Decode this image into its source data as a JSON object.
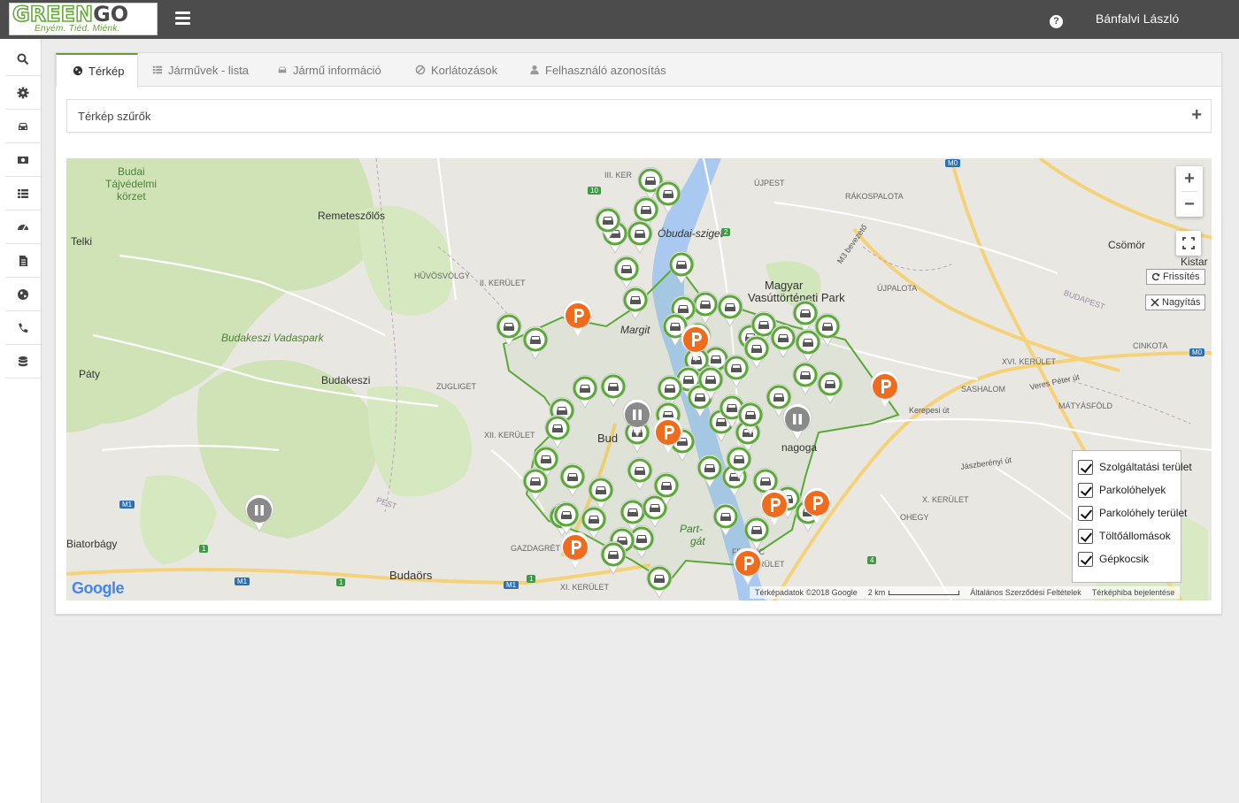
{
  "header": {
    "logo_text_1": "GREEN",
    "logo_text_2": "GO",
    "logo_tagline": "Enyém. Tiéd. Miénk.",
    "help_glyph": "?",
    "user_name": "Bánfalvi László"
  },
  "sidebar": {
    "items": [
      {
        "icon": "search-icon"
      },
      {
        "icon": "gear-icon"
      },
      {
        "icon": "car-icon"
      },
      {
        "icon": "money-icon"
      },
      {
        "icon": "list-icon"
      },
      {
        "icon": "dashboard-icon"
      },
      {
        "icon": "document-icon"
      },
      {
        "icon": "globe-icon"
      },
      {
        "icon": "phone-icon"
      },
      {
        "icon": "database-icon"
      }
    ]
  },
  "tabs": [
    {
      "label": "Térkép",
      "icon": "globe-icon",
      "active": true
    },
    {
      "label": "Járművek - lista",
      "icon": "list-icon",
      "active": false
    },
    {
      "label": "Jármű információ",
      "icon": "car-icon",
      "active": false
    },
    {
      "label": "Korlátozások",
      "icon": "ban-icon",
      "active": false
    },
    {
      "label": "Felhasználó azonosítás",
      "icon": "user-icon",
      "active": false
    }
  ],
  "filter": {
    "label": "Térkép szűrők",
    "expand_glyph": "+"
  },
  "map": {
    "zoom_in": "+",
    "zoom_out": "−",
    "refresh_label": "Frissítés",
    "zoom_label": "Nagyítás",
    "google_logo": "Google",
    "attribution": "Térképadatok ©2018 Google",
    "scale": "2 km",
    "terms": "Általános Szerződési Feltételek",
    "report": "Térképhiba bejelentése",
    "legend": [
      {
        "label": "Szolgáltatási terület",
        "checked": true
      },
      {
        "label": "Parkolóhelyek",
        "checked": true
      },
      {
        "label": "Parkolóhely terület",
        "checked": true
      },
      {
        "label": "Töltőállomások",
        "checked": true
      },
      {
        "label": "Gépkocsik",
        "checked": true
      }
    ],
    "place_labels": [
      {
        "text": "Budai"
      },
      {
        "text": "Tájvédelmi"
      },
      {
        "text": "körzet"
      },
      {
        "text": "Remeteszőlős"
      },
      {
        "text": "Telki"
      },
      {
        "text": "HŰVÖSVÖLGY"
      },
      {
        "text": "II. KERÜLET"
      },
      {
        "text": "Budakeszi Vadaspark"
      },
      {
        "text": "Budakeszi"
      },
      {
        "text": "Páty"
      },
      {
        "text": "ZUGLIGET"
      },
      {
        "text": "XII. KERÜLET"
      },
      {
        "text": "Biatorbágy"
      },
      {
        "text": "Budaörs"
      },
      {
        "text": "GAZDAGRÉT"
      },
      {
        "text": "XI. KERÜLET"
      },
      {
        "text": "Margit"
      },
      {
        "text": "Óbudai-sziget"
      },
      {
        "text": "III. KER"
      },
      {
        "text": "ÚJPEST"
      },
      {
        "text": "RÁKOSPALOTA"
      },
      {
        "text": "Magyar"
      },
      {
        "text": "Vasúttörténeti Park"
      },
      {
        "text": "ÚJPALOTA"
      },
      {
        "text": "Csömör"
      },
      {
        "text": "Kistar"
      },
      {
        "text": "XVI. KERÜLET"
      },
      {
        "text": "SASHALOM"
      },
      {
        "text": "MÁTYÁSFÖLD"
      },
      {
        "text": "CINKOTA"
      },
      {
        "text": "Kerepesi út"
      },
      {
        "text": "nagoga"
      },
      {
        "text": "X. KERÜLET"
      },
      {
        "text": "OHEGY"
      },
      {
        "text": "Bud"
      },
      {
        "text": "Part-"
      },
      {
        "text": "gát"
      },
      {
        "text": "KERÜLET"
      },
      {
        "text": "FERENC"
      },
      {
        "text": "Jászberényi út"
      },
      {
        "text": "Veres Péter út"
      },
      {
        "text": "M3 bevezető"
      },
      {
        "text": "PEST"
      },
      {
        "text": "BUDAPEST"
      }
    ],
    "road_badges": [
      {
        "text": "M0"
      },
      {
        "text": "M0"
      },
      {
        "text": "M1"
      },
      {
        "text": "M1"
      },
      {
        "text": "M1"
      },
      {
        "text": "1"
      },
      {
        "text": "1"
      },
      {
        "text": "1"
      },
      {
        "text": "2"
      },
      {
        "text": "4"
      },
      {
        "text": "10"
      }
    ],
    "colors": {
      "car_pin": "#5aa937",
      "parking_pin": "#ef6b1e",
      "charging_pin": "#8a8a8a",
      "service_area": "#5aa937"
    }
  }
}
